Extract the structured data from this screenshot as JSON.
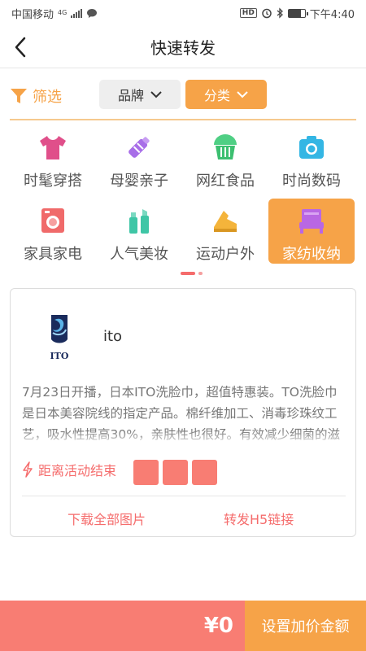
{
  "status_bar": {
    "carrier": "中国移动",
    "network": "4G",
    "hd": "HD",
    "time": "下午4:40"
  },
  "header": {
    "title": "快速转发",
    "back_icon": "chevron-left-icon"
  },
  "filters": {
    "filter_label": "筛选",
    "brand_label": "品牌",
    "category_label": "分类",
    "accent_color": "#f6a348"
  },
  "categories": [
    {
      "label": "时髦穿搭",
      "icon": "tshirt-icon",
      "color": "#e04f8a"
    },
    {
      "label": "母婴亲子",
      "icon": "baby-bottle-icon",
      "color": "#a86ee8"
    },
    {
      "label": "网红食品",
      "icon": "food-basket-icon",
      "color": "#4fcf84"
    },
    {
      "label": "时尚数码",
      "icon": "camera-icon",
      "color": "#34b6e4"
    },
    {
      "label": "家具家电",
      "icon": "washing-machine-icon",
      "color": "#f06a6a"
    },
    {
      "label": "人气美妆",
      "icon": "cosmetics-icon",
      "color": "#3fc6a6"
    },
    {
      "label": "运动户外",
      "icon": "sneaker-icon",
      "color": "#f4b43b"
    },
    {
      "label": "家纺收纳",
      "icon": "bed-icon",
      "color": "#b967e3",
      "active": true
    }
  ],
  "card": {
    "brand_logo_text": "ITO",
    "brand_name": "ito",
    "description": "7月23日开播，日本ITO洗脸巾，超值特惠装。TO洗脸巾是日本美容院线的指定产品。棉纤维加工、消毒珍珠纹工艺，吸水性提高30%，亲肤性也很好。有效减少细菌的滋生，更加呵护脸部肌肤。",
    "countdown_label": "距离活动结束",
    "download_label": "下载全部图片",
    "share_label": "转发H5链接"
  },
  "bottom": {
    "price": "¥0",
    "set_price_label": "设置加价金额",
    "price_bg": "#f87d73",
    "button_bg": "#f6a348"
  }
}
